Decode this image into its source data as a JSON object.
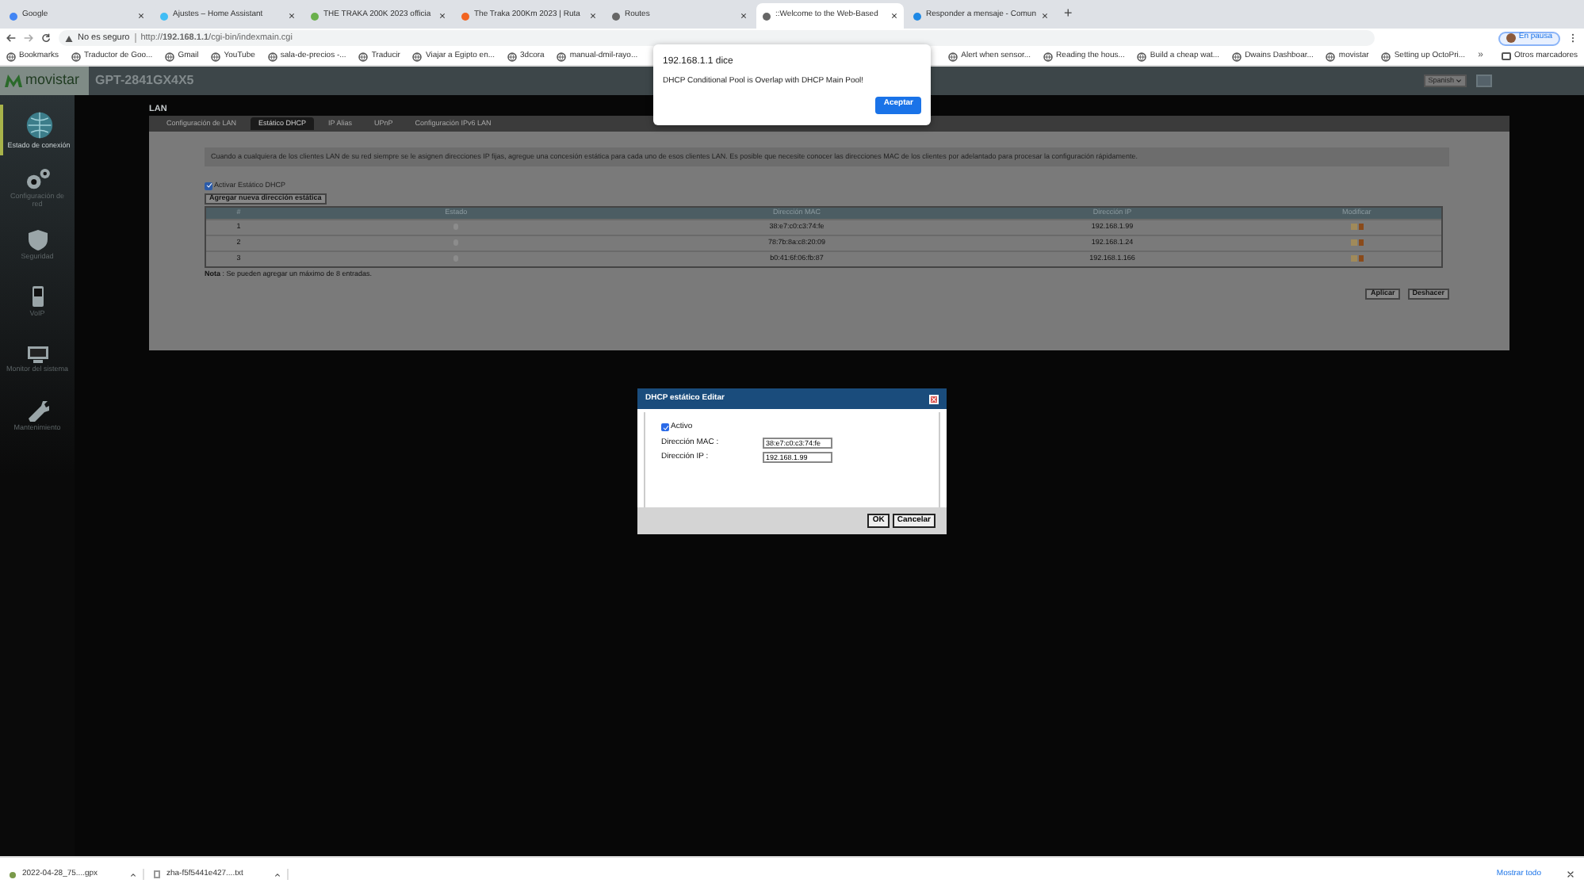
{
  "browser": {
    "tabs": [
      {
        "title": "Google",
        "selected": false
      },
      {
        "title": "Ajustes – Home Assistant",
        "selected": false
      },
      {
        "title": "THE TRAKA 200K 2023 officia",
        "selected": false
      },
      {
        "title": "The Traka 200Km 2023 | Ruta",
        "selected": false
      },
      {
        "title": "Routes",
        "selected": false
      },
      {
        "title": "::Welcome to the Web-Based",
        "selected": true
      },
      {
        "title": "Responder a mensaje - Comun",
        "selected": false
      }
    ],
    "new_tab": "+",
    "security": "No es seguro",
    "url": "http://**192.168.1.1**/cgi-bin/indexmain.cgi",
    "profile": "En pausa",
    "bookmarks_left": [
      "Bookmarks",
      "Traductor de Goo...",
      "Gmail",
      "YouTube",
      "sala-de-precios -...",
      "Traducir",
      "Viajar a Egipto en...",
      "3dcora",
      "manual-dmil-rayo..."
    ],
    "bookmarks_right": [
      "Alert when sensor...",
      "Reading the hous...",
      "Build a cheap wat...",
      "Dwains Dashboar...",
      "movistar",
      "Setting up OctoPri..."
    ],
    "more": "»",
    "other_bookmarks": "Otros marcadores"
  },
  "router": {
    "brand": "movistar",
    "model": "GPT-2841GX4X5",
    "language": "Spanish",
    "sidebar": [
      {
        "label": "Estado de conexión",
        "selected": true
      },
      {
        "label": "Configuración de red",
        "selected": false
      },
      {
        "label": "Seguridad",
        "selected": false
      },
      {
        "label": "VoIP",
        "selected": false
      },
      {
        "label": "Monitor del sistema",
        "selected": false
      },
      {
        "label": "Mantenimiento",
        "selected": false
      }
    ],
    "section": "LAN",
    "tabs": [
      {
        "label": "Configuración de LAN",
        "selected": false
      },
      {
        "label": "Estático DHCP",
        "selected": true
      },
      {
        "label": "IP Alias",
        "selected": false
      },
      {
        "label": "UPnP",
        "selected": false
      },
      {
        "label": "Configuración IPv6 LAN",
        "selected": false
      }
    ],
    "info": "Cuando a cualquiera de los clientes LAN de su red siempre se le asignen direcciones IP fijas, agregue una concesión estática para cada uno de esos clientes LAN. Es posible que necesite conocer las direcciones MAC de los clientes por adelantado para procesar la configuración rápidamente.",
    "enable": {
      "label": "Activar Estático DHCP",
      "checked": true
    },
    "add_button": "Agregar nueva dirección estática",
    "columns": [
      "#",
      "Estado",
      "Dirección MAC",
      "Dirección IP",
      "Modificar"
    ],
    "rows": [
      {
        "index": "1",
        "mac": "38:e7:c0:c3:74:fe",
        "ip": "192.168.1.99"
      },
      {
        "index": "2",
        "mac": "78:7b:8a:c8:20:09",
        "ip": "192.168.1.24"
      },
      {
        "index": "3",
        "mac": "b0:41:6f:06:fb:87",
        "ip": "192.168.1.166"
      }
    ],
    "note": "**Nota** : Se pueden agregar un máximo de 8 entradas.",
    "buttons": [
      "Aplicar",
      "Deshacer"
    ]
  },
  "modal": {
    "title": "DHCP estático Editar",
    "active": {
      "label": "Activo",
      "checked": true
    },
    "fields": [
      {
        "label": "Dirección MAC :",
        "value": "38:e7:c0:c3:74:fe"
      },
      {
        "label": "Dirección IP :",
        "value": "192.168.1.99"
      }
    ],
    "buttons": [
      "OK",
      "Cancelar"
    ]
  },
  "alert": {
    "title": "192.168.1.1 dice",
    "message": "DHCP Conditional Pool is Overlap with DHCP Main Pool!",
    "button": "Aceptar"
  },
  "downloads": {
    "items": [
      {
        "name": "2022-04-28_75....gpx",
        "kind": "gpx"
      },
      {
        "name": "zha-f5f5441e427....txt",
        "kind": "txt"
      }
    ],
    "show_all": "Mostrar todo"
  }
}
